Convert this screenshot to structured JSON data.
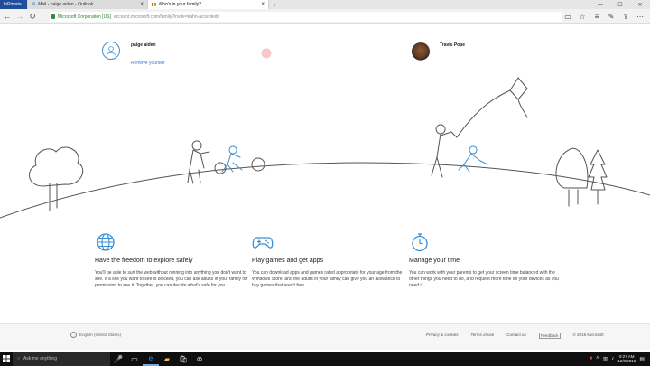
{
  "browser": {
    "tabs": [
      {
        "label": "InPrivate"
      },
      {
        "label": "Mail - paige aiden - Outlook"
      },
      {
        "label": "Who's in your family?"
      }
    ],
    "address": {
      "org": "Microsoft Corporation [US]",
      "url": "account.microsoft.com/family?invite=kahn-accepted#"
    }
  },
  "family": {
    "members": [
      {
        "name": "paige aiden",
        "action": "Remove yourself"
      },
      {
        "name": ""
      },
      {
        "name": "Travis Pope"
      }
    ]
  },
  "features": [
    {
      "icon": "globe-icon",
      "title": "Have the freedom to explore safely",
      "text": "You'll be able to surf the web without running into anything you don't want to see. If a site you want to see is blocked, you can ask adults in your family for permission to see it. Together, you can decide what's safe for you."
    },
    {
      "icon": "gamepad-icon",
      "title": "Play games and get apps",
      "text": "You can download apps and games rated appropriate for your age from the Windows Store, and the adults in your family can give you an allowance to buy games that aren't free."
    },
    {
      "icon": "stopwatch-icon",
      "title": "Manage your time",
      "text": "You can work with your parents to get your screen time balanced with the other things you need to do, and request more time on your devices as you need it."
    }
  ],
  "footer": {
    "language": "English (United States)",
    "links": [
      "Privacy & cookies",
      "Terms of use",
      "Contact us",
      "Feedback",
      "© 2016 Microsoft"
    ]
  },
  "taskbar": {
    "search_placeholder": "Ask me anything",
    "time": "9:27 AM",
    "date": "12/8/2016"
  },
  "colors": {
    "accent": "#2b7bd0",
    "icon_blue": "#3b8fd4",
    "private_tab": "#1f4e9c"
  }
}
